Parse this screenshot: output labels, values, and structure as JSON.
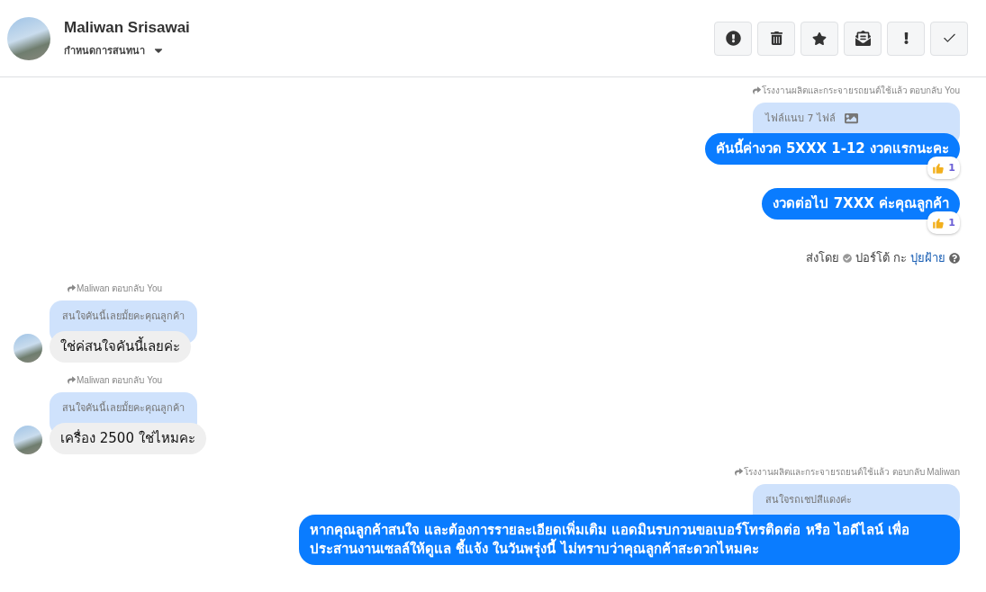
{
  "header": {
    "name": "Maliwan Srisawai",
    "subtitle": "กำหนดการสนทนา"
  },
  "messages": [
    {
      "kind": "outgoing",
      "reply_label": "โรงงานผลิตและกระจายรถยนต์ใช้แล้ว ตอบกลับ You",
      "quote": "ไฟล์แนบ 7 ไฟล์",
      "quote_attachment": true,
      "text": "คันนี้ค่างวด 5XXX  1-12 งวดแรกนะคะ",
      "reaction_count": "1"
    },
    {
      "kind": "outgoing",
      "text": "งวดต่อไป 7XXX  ค่ะคุณลูกค้า",
      "reaction_count": "1"
    },
    {
      "kind": "sent_by",
      "label": "ส่งโดย",
      "sender": "ปอร์โต้ กะ",
      "link": "ปุยฝ้าย"
    },
    {
      "kind": "incoming",
      "reply_label": "Maliwan ตอบกลับ You",
      "quote": "สนใจคันนี้เลยมั้ยคะคุณลูกค้า",
      "text": "ใช่ค่สนใจคันนี้เลยค่ะ"
    },
    {
      "kind": "incoming",
      "reply_label": "Maliwan ตอบกลับ You",
      "quote": "สนใจคันนี้เลยมั้ยคะคุณลูกค้า",
      "text": "เครื่อง 2500 ใช่ไหมคะ"
    },
    {
      "kind": "outgoing",
      "reply_label": "โรงงานผลิตและกระจายรถยนต์ใช้แล้ว ตอบกลับ Maliwan",
      "quote": "สนใจรถเชปสีแดงค่ะ",
      "text": "หากคุณลูกค้าสนใจ และต้องการรายละเอียดเพิ่มเติม แอดมินรบกวนขอเบอร์โทรติดต่อ หรือ ไอดีไลน์ เพื่อ ประสานงานเซลล์ให้ดูแล ชี้แจ้ง ในวันพรุ่งนี้ ไม่ทราบว่าคุณลูกค้าสะดวกไหมคะ"
    }
  ]
}
